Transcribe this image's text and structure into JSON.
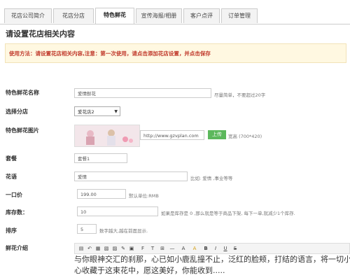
{
  "tabs": [
    "花店公司简介",
    "花店分店",
    "特色鲜花",
    "宣传海报/相册",
    "客户点评",
    "订单管理"
  ],
  "page_title": "请设置花店相关内容",
  "usage_note": "使用方法：请设置花店相关内容,注意：第一次使用，请点击添加花店设置，并点击保存",
  "form": {
    "name": {
      "label": "特色鲜花名称",
      "value": "爱情鲜花",
      "hint": "尽量简单，不要超过20字"
    },
    "branch": {
      "label": "选择分店",
      "value": "爱花店2"
    },
    "image": {
      "label": "特色鲜花图片",
      "url": "http://www.gzvplan.com",
      "upload": "上传",
      "size_hint": "宽高 (700*420)"
    },
    "package": {
      "label": "套餐",
      "value": "套餐1"
    },
    "flower_language": {
      "label": "花语",
      "value": "爱情",
      "hint": "比如: 爱情 ,事业等等"
    },
    "price": {
      "label": "一口价",
      "value": "199.00",
      "hint": "默认单位:RMB"
    },
    "stock": {
      "label": "库存数：",
      "value": "10",
      "hint": "如果是库存是 0 ,那么就是等于商品下架, 每下一单,就减少1个库存."
    },
    "sort": {
      "label": "排序",
      "value": "5",
      "hint": "数字越大,越在前面显示."
    },
    "intro": {
      "label": "鲜花介绍",
      "content_line1": "与你眼神交汇的刹那，心已如小鹿乱撞不止，泛红的脸颊，打结的语言，将一切小",
      "content_line2": "心收藏于这束花中，愿这美好，你能收到....."
    }
  },
  "editor_toolbar_icons": [
    "source-icon",
    "undo-icon",
    "paste-icon",
    "paste-text-icon",
    "paste-word-icon",
    "brush-icon",
    "image-icon",
    "font-family-icon",
    "font-size-icon",
    "insert-table-icon",
    "hr-icon",
    "font-color-icon",
    "bg-color-icon",
    "bold-icon",
    "italic-icon",
    "underline-icon",
    "strike-icon"
  ],
  "colors": {
    "upload_button": "#5cb85c",
    "usage_text": "#c0392b",
    "usage_bg": "#fff8e1"
  }
}
